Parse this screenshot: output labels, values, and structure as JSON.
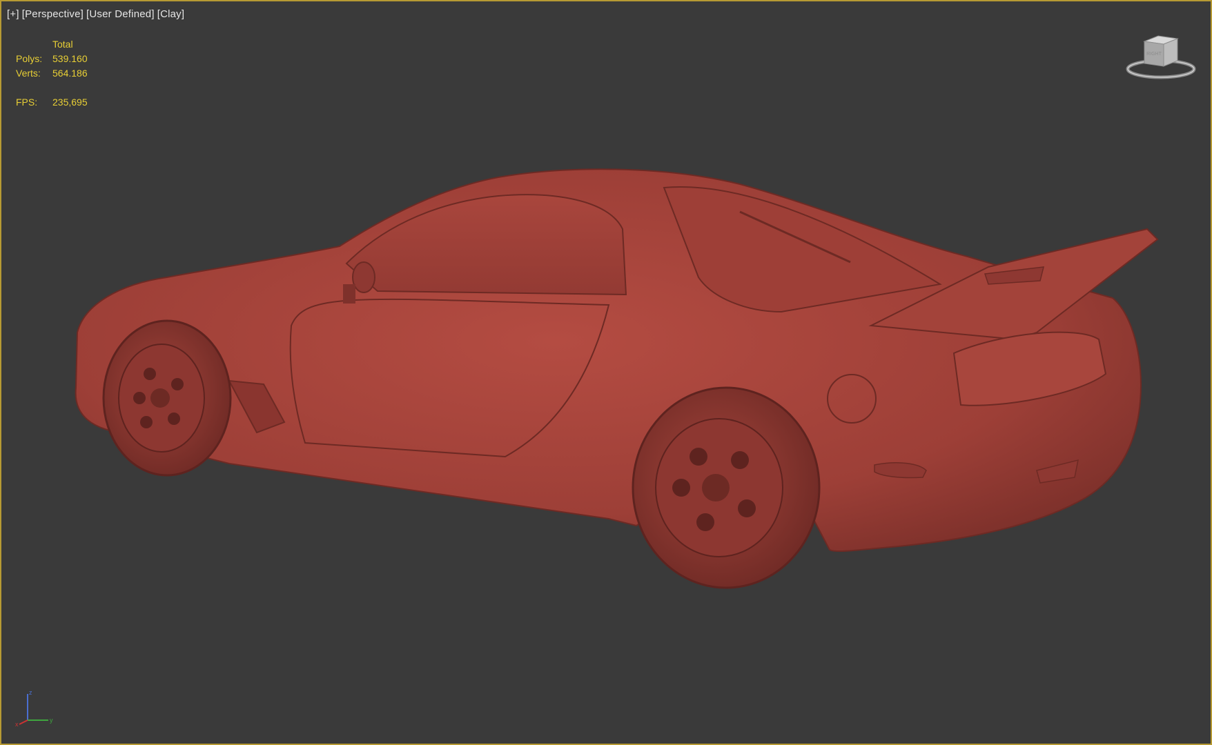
{
  "viewport": {
    "labels": [
      "[+]",
      "[Perspective]",
      "[User Defined]",
      "[Clay]"
    ]
  },
  "stats": {
    "header": "Total",
    "polys_label": "Polys:",
    "polys_value": "539.160",
    "verts_label": "Verts:",
    "verts_value": "564.186",
    "fps_label": "FPS:",
    "fps_value": "235,695"
  },
  "viewcube": {
    "face_label": "RIGHT"
  },
  "axis": {
    "x": "x",
    "y": "y",
    "z": "z"
  },
  "colors": {
    "background": "#3a3a3a",
    "viewport_border": "#b79a33",
    "stats_text": "#e8cf35",
    "clay": "#a8423a"
  },
  "icons": [
    "viewcube-icon",
    "axis-tripod-icon"
  ]
}
